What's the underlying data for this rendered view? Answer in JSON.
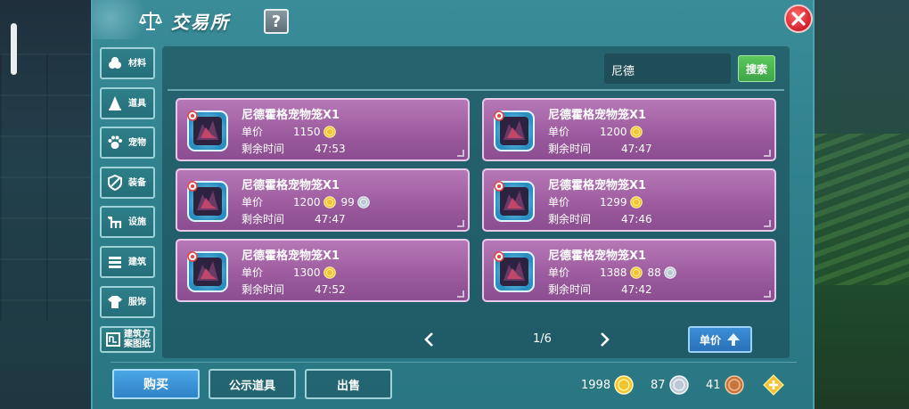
{
  "window": {
    "title": "交易所",
    "help_label": "?"
  },
  "categories": [
    {
      "label": "材料",
      "icon": "materials-icon"
    },
    {
      "label": "道具",
      "icon": "props-icon"
    },
    {
      "label": "宠物",
      "icon": "pet-paw-icon"
    },
    {
      "label": "装备",
      "icon": "equipment-icon"
    },
    {
      "label": "设施",
      "icon": "facility-icon"
    },
    {
      "label": "建筑",
      "icon": "building-icon"
    },
    {
      "label": "服饰",
      "icon": "clothing-icon"
    },
    {
      "label": "建筑方案图纸",
      "icon": "blueprint-icon"
    }
  ],
  "search": {
    "value": "尼德",
    "button_label": "搜索"
  },
  "listing_labels": {
    "price": "单价",
    "time_left": "剩余时间"
  },
  "listings": [
    {
      "name": "尼德霍格宠物笼X1",
      "gold": "1150",
      "silver": "",
      "time": "47:53"
    },
    {
      "name": "尼德霍格宠物笼X1",
      "gold": "1200",
      "silver": "",
      "time": "47:47"
    },
    {
      "name": "尼德霍格宠物笼X1",
      "gold": "1200",
      "silver": "99",
      "time": "47:47"
    },
    {
      "name": "尼德霍格宠物笼X1",
      "gold": "1299",
      "silver": "",
      "time": "47:46"
    },
    {
      "name": "尼德霍格宠物笼X1",
      "gold": "1300",
      "silver": "",
      "time": "47:52"
    },
    {
      "name": "尼德霍格宠物笼X1",
      "gold": "1388",
      "silver": "88",
      "time": "47:42"
    }
  ],
  "pagination": {
    "text": "1/6"
  },
  "sort": {
    "label": "单价"
  },
  "bottom": {
    "buy_label": "购买",
    "show_label": "公示道具",
    "sell_label": "出售"
  },
  "wallet": {
    "gold": "1998",
    "silver": "87",
    "copper": "41"
  },
  "colors": {
    "panel": "#2f7f8c",
    "listing": "#9a5a9d",
    "search_button": "#4db74f",
    "buy_button": "#3b95d8",
    "close_button": "#d21f2c",
    "gold_coin": "#f2c530"
  }
}
